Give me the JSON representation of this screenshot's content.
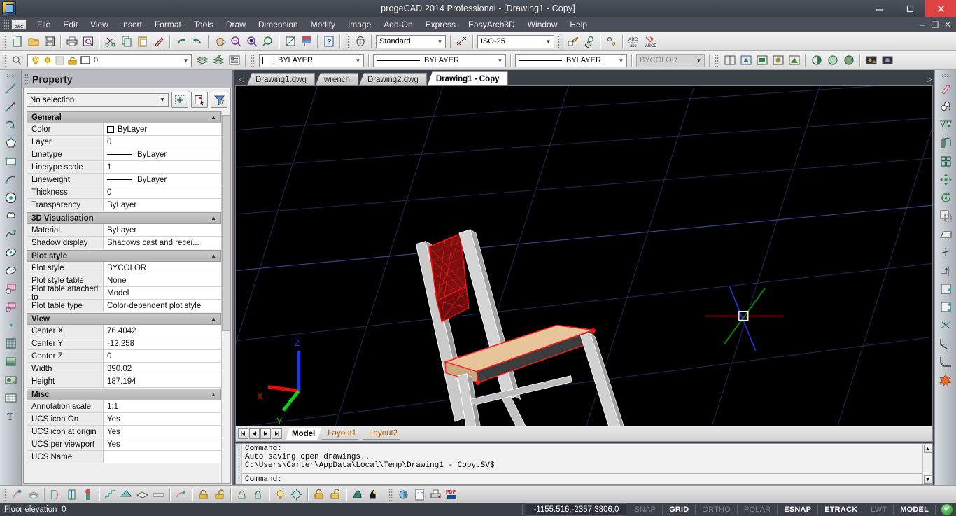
{
  "window": {
    "title": "progeCAD 2014 Professional - [Drawing1 - Copy]",
    "minimize": "–",
    "maximize": "❐",
    "close": "✕",
    "doc_minimize": "–",
    "doc_restore": "❐",
    "doc_close": "✕"
  },
  "menu": {
    "items": [
      "File",
      "Edit",
      "View",
      "Insert",
      "Format",
      "Tools",
      "Draw",
      "Dimension",
      "Modify",
      "Image",
      "Add-On",
      "Express",
      "EasyArch3D",
      "Window",
      "Help"
    ]
  },
  "toolbar_standard": {
    "text_style": "Standard",
    "dim_style": "ISO-25"
  },
  "toolbar_layer": {
    "layer_name": "0",
    "color": "BYLAYER",
    "linetype": "BYLAYER",
    "lineweight": "BYLAYER",
    "plotstyle": "BYCOLOR"
  },
  "property_panel": {
    "title": "Property",
    "selection": "No selection",
    "buttons": [
      "quick-select-button",
      "pick-add-button",
      "filter-button"
    ],
    "categories": [
      {
        "name": "General",
        "rows": [
          {
            "name": "Color",
            "value": "ByLayer",
            "type": "color"
          },
          {
            "name": "Layer",
            "value": "0",
            "type": "text"
          },
          {
            "name": "Linetype",
            "value": "ByLayer",
            "type": "linetype"
          },
          {
            "name": "Linetype scale",
            "value": "1",
            "type": "text"
          },
          {
            "name": "Lineweight",
            "value": "ByLayer",
            "type": "linetype"
          },
          {
            "name": "Thickness",
            "value": "0",
            "type": "text"
          },
          {
            "name": "Transparency",
            "value": "ByLayer",
            "type": "text"
          }
        ]
      },
      {
        "name": "3D Visualisation",
        "rows": [
          {
            "name": "Material",
            "value": "ByLayer",
            "type": "text"
          },
          {
            "name": "Shadow display",
            "value": "Shadows cast and recei...",
            "type": "text"
          }
        ]
      },
      {
        "name": "Plot style",
        "rows": [
          {
            "name": "Plot style",
            "value": "BYCOLOR",
            "type": "text"
          },
          {
            "name": "Plot style table",
            "value": "None",
            "type": "text"
          },
          {
            "name": "Plot table attached to",
            "value": "Model",
            "type": "text"
          },
          {
            "name": "Plot table type",
            "value": "Color-dependent plot style",
            "type": "text"
          }
        ]
      },
      {
        "name": "View",
        "rows": [
          {
            "name": "Center X",
            "value": "76.4042",
            "type": "text"
          },
          {
            "name": "Center Y",
            "value": "-12.258",
            "type": "text"
          },
          {
            "name": "Center Z",
            "value": "0",
            "type": "text"
          },
          {
            "name": "Width",
            "value": "390.02",
            "type": "text"
          },
          {
            "name": "Height",
            "value": "187.194",
            "type": "text"
          }
        ]
      },
      {
        "name": "Misc",
        "rows": [
          {
            "name": "Annotation scale",
            "value": "1:1",
            "type": "text"
          },
          {
            "name": "UCS icon On",
            "value": "Yes",
            "type": "text"
          },
          {
            "name": "UCS icon at origin",
            "value": "Yes",
            "type": "text"
          },
          {
            "name": "UCS per viewport",
            "value": "Yes",
            "type": "text"
          },
          {
            "name": "UCS Name",
            "value": "",
            "type": "text"
          }
        ]
      }
    ]
  },
  "document_tabs": {
    "prev_arrow": "◁",
    "next_arrow": "▷",
    "tabs": [
      {
        "label": "Drawing1.dwg",
        "active": false
      },
      {
        "label": "wrench",
        "active": false
      },
      {
        "label": "Drawing2.dwg",
        "active": false
      },
      {
        "label": "Drawing1 - Copy",
        "active": true
      }
    ]
  },
  "layout_bar": {
    "nav": [
      "⏮",
      "◀",
      "▶",
      "⏭"
    ],
    "tabs": [
      {
        "label": "Model",
        "active": true
      },
      {
        "label": "Layout1",
        "active": false
      },
      {
        "label": "Layout2",
        "active": false
      }
    ]
  },
  "command_bar": {
    "history": [
      "Command:",
      "Auto saving open drawings...",
      "C:\\Users\\Carter\\AppData\\Local\\Temp\\Drawing1 - Copy.SV$"
    ],
    "prompt": "Command:",
    "scroll_up": "▲",
    "scroll_down": "▼"
  },
  "status_bar": {
    "left_text": "Floor elevation=0",
    "coordinates": "-1155.516,-2357.3806,0",
    "toggles": [
      {
        "label": "SNAP",
        "on": false
      },
      {
        "label": "GRID",
        "on": true
      },
      {
        "label": "ORTHO",
        "on": false
      },
      {
        "label": "POLAR",
        "on": false
      },
      {
        "label": "ESNAP",
        "on": true
      },
      {
        "label": "ETRACK",
        "on": true
      },
      {
        "label": "LWT",
        "on": false
      },
      {
        "label": "MODEL",
        "on": true
      }
    ],
    "status_icon": "✔"
  },
  "canvas": {
    "background": "#000000",
    "grid_color": "#2b2f5a",
    "ucs": {
      "x_label": "X",
      "y_label": "Y",
      "z_label": "Z",
      "x_color": "#e01010",
      "y_color": "#16cc16",
      "z_color": "#1a3ae8"
    },
    "model": {
      "name": "chair-3d-model",
      "frame_color": "#c9c9c9",
      "seat_color": "#e8c49a",
      "back_color": "#8b0f0f",
      "edge_color": "#ff0000"
    },
    "crosshair": {
      "x_color": "#cc0000",
      "y_color": "#00a000",
      "z_color": "#1a3ae8"
    }
  },
  "left_toolbar": {
    "items": [
      "line-icon",
      "ray-icon",
      "polyline-icon",
      "polygon-icon",
      "rectangle-icon",
      "arc-icon",
      "circle-icon",
      "revision-cloud-icon",
      "spline-icon",
      "ellipse-icon",
      "ellipse-arc-icon",
      "insert-block-icon",
      "make-block-icon",
      "point-icon",
      "hatch-icon",
      "gradient-icon",
      "raster-image-icon",
      "table-icon",
      "text-icon"
    ]
  },
  "right_toolbar": {
    "items": [
      "erase-icon",
      "copy-icon",
      "mirror-icon",
      "offset-icon",
      "array-icon",
      "move-icon",
      "rotate-icon",
      "scale-icon",
      "stretch-icon",
      "trim-icon",
      "extend-icon",
      "break-at-point-icon",
      "break-icon",
      "join-icon",
      "chamfer-icon",
      "fillet-icon",
      "explode-icon"
    ]
  },
  "bottom_toolbar": {
    "items": [
      "easyarch-wall-icon",
      "easyarch-layers-icon",
      "easyarch-door-icon",
      "easyarch-window-icon",
      "easyarch-column-icon",
      "easyarch-stair-icon",
      "easyarch-roof-icon",
      "easyarch-slab-icon",
      "easyarch-beam-icon",
      "easyarch-dim-icon",
      "easyarch-tag-icon",
      "easyarch-room-icon",
      "easyarch-furniture-icon",
      "easyarch-symbol-icon",
      "easyarch-light-icon",
      "easyarch-render-icon",
      "easyarch-section-icon",
      "easyarch-elevation-icon",
      "easyarch-3dview-icon",
      "easyarch-export-icon",
      "render-icon",
      "page-setup-icon",
      "plot-icon",
      "pdf-export-icon"
    ]
  }
}
